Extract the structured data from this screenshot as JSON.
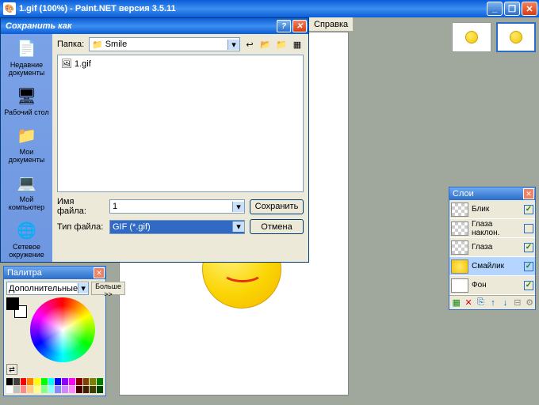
{
  "app": {
    "title": "1.gif (100%) - Paint.NET версия 3.5.11",
    "menu_help": "Справка"
  },
  "save_dialog": {
    "title": "Сохранить как",
    "folder_label": "Папка:",
    "folder_value": "Smile",
    "file_shown": "1.gif",
    "filename_label": "Имя файла:",
    "filename_value": "1",
    "filetype_label": "Тип файла:",
    "filetype_value": "GIF (*.gif)",
    "save_btn": "Сохранить",
    "cancel_btn": "Отмена",
    "places": [
      {
        "label": "Недавние документы",
        "icon": "📄"
      },
      {
        "label": "Рабочий стол",
        "icon": "🖥"
      },
      {
        "label": "Мои документы",
        "icon": "📁"
      },
      {
        "label": "Мой компьютер",
        "icon": "💻"
      },
      {
        "label": "Сетевое окружение",
        "icon": "🌐"
      }
    ]
  },
  "layers_panel": {
    "title": "Слои",
    "layers": [
      {
        "name": "Блик",
        "visible": true
      },
      {
        "name": "Глаза наклон.",
        "visible": false
      },
      {
        "name": "Глаза",
        "visible": true
      },
      {
        "name": "Смайлик",
        "visible": true,
        "selected": true
      },
      {
        "name": "Фон",
        "visible": true,
        "white": true
      }
    ]
  },
  "palette_panel": {
    "title": "Палитра",
    "mode": "Дополнительные",
    "more": "Больше >>",
    "row1": [
      "#000",
      "#404040",
      "#f00",
      "#ff8000",
      "#ff0",
      "#0f0",
      "#0ff",
      "#00f",
      "#80f",
      "#f0f",
      "#800",
      "#804000",
      "#808000",
      "#008000"
    ],
    "row2": [
      "#fff",
      "#c0c0c0",
      "#f88",
      "#fc8",
      "#ff8",
      "#8f8",
      "#8ff",
      "#88f",
      "#c8f",
      "#f8f",
      "#400",
      "#402000",
      "#404000",
      "#004000"
    ]
  }
}
